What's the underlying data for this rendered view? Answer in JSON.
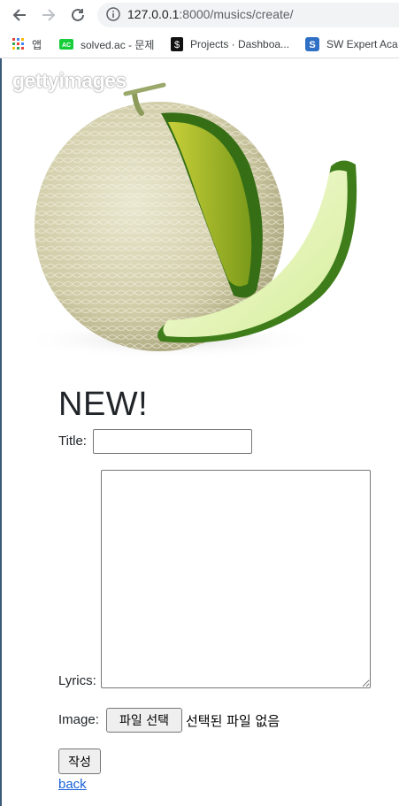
{
  "browser": {
    "url_host": "127.0.0.1",
    "url_path": ":8000/musics/create/",
    "bookmarks": [
      {
        "label": "앱",
        "icon": "apps-grid-icon"
      },
      {
        "label": "solved.ac - 문제",
        "icon": "solved-ac-icon"
      },
      {
        "label": "Projects · Dashboa...",
        "icon": "gitlab-dollar-icon"
      },
      {
        "label": "SW Expert Aca",
        "icon": "swea-s-icon"
      }
    ]
  },
  "page": {
    "watermark": "gettyimages",
    "heading": "NEW!",
    "title_label": "Title:",
    "lyrics_label": "Lyrics:",
    "image_label": "Image:",
    "file_button": "파일 선택",
    "file_status": "선택된 파일 없음",
    "submit_button": "작성",
    "back_link": "back"
  },
  "colors": {
    "link": "#1a62d9",
    "input_border": "#767676",
    "button_bg": "#efefef"
  }
}
